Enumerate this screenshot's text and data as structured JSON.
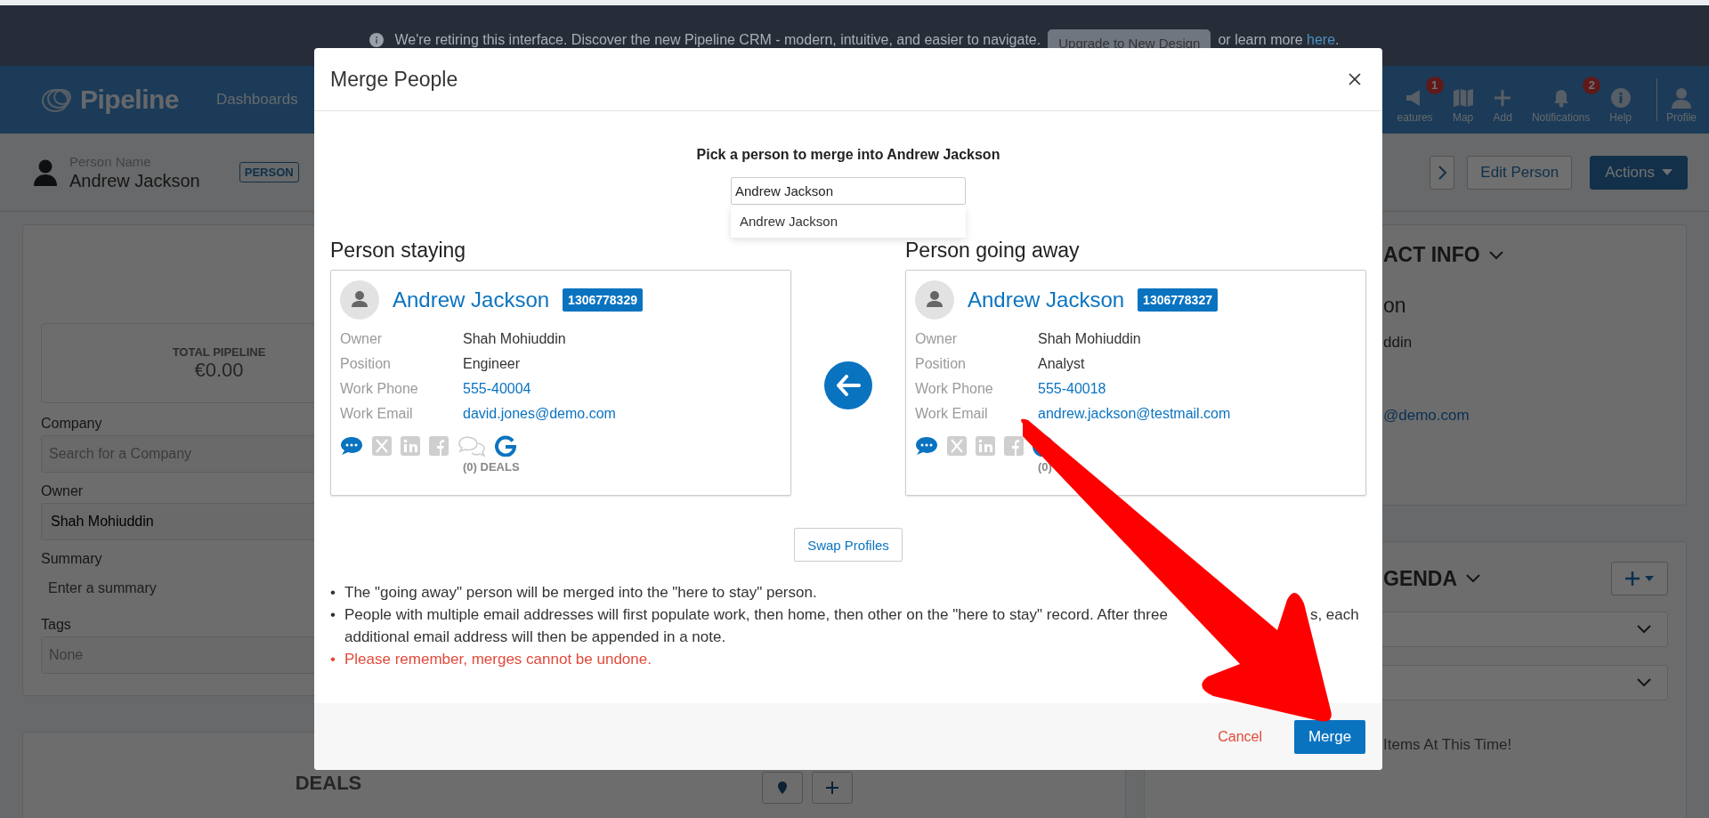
{
  "banner": {
    "message": "We're retiring this interface. Discover the new Pipeline CRM - modern, intuitive, and easier to navigate.",
    "button": "Upgrade to New Design",
    "more_text": "or learn more",
    "link": "here",
    "more_end": "."
  },
  "header": {
    "logo": "Pipeline",
    "nav": [
      "Dashboards"
    ],
    "tools": [
      {
        "label": "eatures",
        "kind": "megaphone",
        "badge": "1"
      },
      {
        "label": "Map",
        "kind": "map"
      },
      {
        "label": "Add",
        "kind": "plus"
      },
      {
        "label": "Notifications",
        "kind": "bell",
        "badge": "2"
      },
      {
        "label": "Help",
        "kind": "info"
      },
      {
        "label": "Profile",
        "kind": "person"
      }
    ]
  },
  "person_bar": {
    "label": "Person Name",
    "name": "Andrew Jackson",
    "badge": "PERSON",
    "edit_button": "Edit Person",
    "actions_button": "Actions"
  },
  "details": {
    "total_label": "TOTAL PIPELINE",
    "total_value": "€0.00",
    "fields": [
      {
        "label": "Company",
        "kind": "input",
        "placeholder": "Search for a Company"
      },
      {
        "label": "Owner",
        "kind": "input",
        "value": "Shah Mohiuddin"
      },
      {
        "label": "Summary",
        "kind": "plain",
        "placeholder": "Enter a summary"
      },
      {
        "label": "Tags",
        "kind": "input",
        "placeholder": "None"
      }
    ]
  },
  "deals": {
    "title": "DEALS"
  },
  "contact": {
    "title": "ACT INFO",
    "lines": [
      {
        "text": "on",
        "kind": "large"
      },
      {
        "text": "ddin",
        "kind": "text"
      },
      {
        "text": "@demo.com",
        "kind": "link"
      }
    ]
  },
  "agenda": {
    "title": "GENDA",
    "empty_text": "Items At This Time!"
  },
  "modal": {
    "title": "Merge People",
    "prompt": "Pick a person to merge into Andrew Jackson",
    "search_value": "Andrew Jackson",
    "suggestions": [
      "Andrew Jackson"
    ],
    "staying": {
      "heading": "Person staying",
      "name": "Andrew Jackson",
      "id": "1306778329",
      "rows": [
        {
          "label": "Owner",
          "value": "Shah Mohiuddin",
          "kind": "text"
        },
        {
          "label": "Position",
          "value": "Engineer",
          "kind": "text"
        },
        {
          "label": "Work Phone",
          "value": "555-40004",
          "kind": "link"
        },
        {
          "label": "Work Email",
          "value": "david.jones@demo.com",
          "kind": "link"
        }
      ],
      "icons": [
        {
          "kind": "sms"
        },
        {
          "kind": "x"
        },
        {
          "kind": "linkedin"
        },
        {
          "kind": "facebook"
        },
        {
          "kind": "chat"
        },
        {
          "kind": "google"
        }
      ],
      "deals": "(0) DEALS"
    },
    "going": {
      "heading": "Person going away",
      "name": "Andrew Jackson",
      "id": "1306778327",
      "rows": [
        {
          "label": "Owner",
          "value": "Shah Mohiuddin",
          "kind": "text"
        },
        {
          "label": "Position",
          "value": "Analyst",
          "kind": "text"
        },
        {
          "label": "Work Phone",
          "value": "555-40018",
          "kind": "link"
        },
        {
          "label": "Work Email",
          "value": "andrew.jackson@testmail.com",
          "kind": "link"
        }
      ],
      "icons": [
        {
          "kind": "sms"
        },
        {
          "kind": "x"
        },
        {
          "kind": "linkedin"
        },
        {
          "kind": "facebook"
        },
        {
          "kind": "google"
        }
      ],
      "deals": "(0)"
    },
    "swap_button": "Swap Profiles",
    "notes": [
      {
        "kind": "info",
        "bullet": "•",
        "parts": [
          "The \"going away\" person will be merged into the \"here to stay\" person."
        ]
      },
      {
        "kind": "info",
        "bullet": "•",
        "parts": [
          "People with multiple email addresses will first populate work, then home, then other on the \"here to stay\" record. After three",
          "s, each",
          "additional email address will then be appended in a note."
        ]
      },
      {
        "kind": "warning",
        "bullet": "•",
        "parts": [
          "Please remember, merges cannot be undone."
        ]
      }
    ],
    "cancel_button": "Cancel",
    "merge_button": "Merge"
  }
}
